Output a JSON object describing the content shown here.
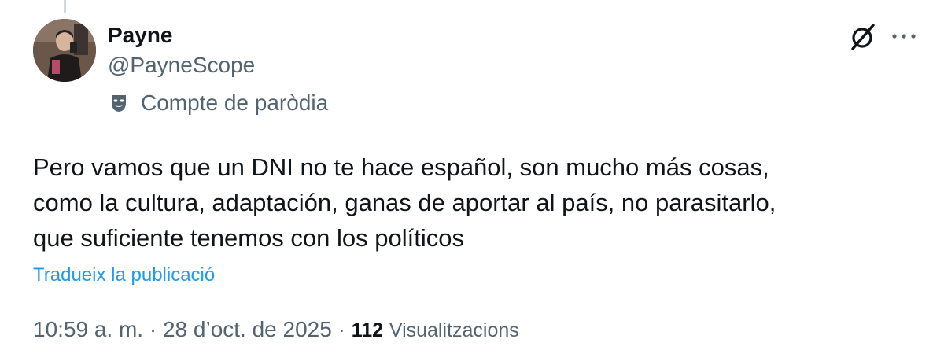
{
  "author": {
    "name": "Payne",
    "handle": "@PayneScope",
    "label": "Compte de paròdia",
    "avatar_icon": "avatar-photo",
    "label_icon": "parody-mask-icon"
  },
  "actions": {
    "grok_icon": "grok-icon",
    "more_icon": "more-icon"
  },
  "tweet": {
    "lines": [
      "Pero vamos que un DNI no te hace español, son mucho más cosas,",
      "como la cultura, adaptación, ganas de aportar al país, no parasitarlo,",
      "que suficiente tenemos con los políticos"
    ],
    "translate_link": "Tradueix la publicació"
  },
  "meta": {
    "time": "10:59 a. m.",
    "separator": "·",
    "date": "28 d’oct. de 2025",
    "views_count": "112",
    "views_label": "Visualitzacions"
  },
  "colors": {
    "text": "#0f1419",
    "secondary": "#536471",
    "link": "#1d9bf0"
  }
}
